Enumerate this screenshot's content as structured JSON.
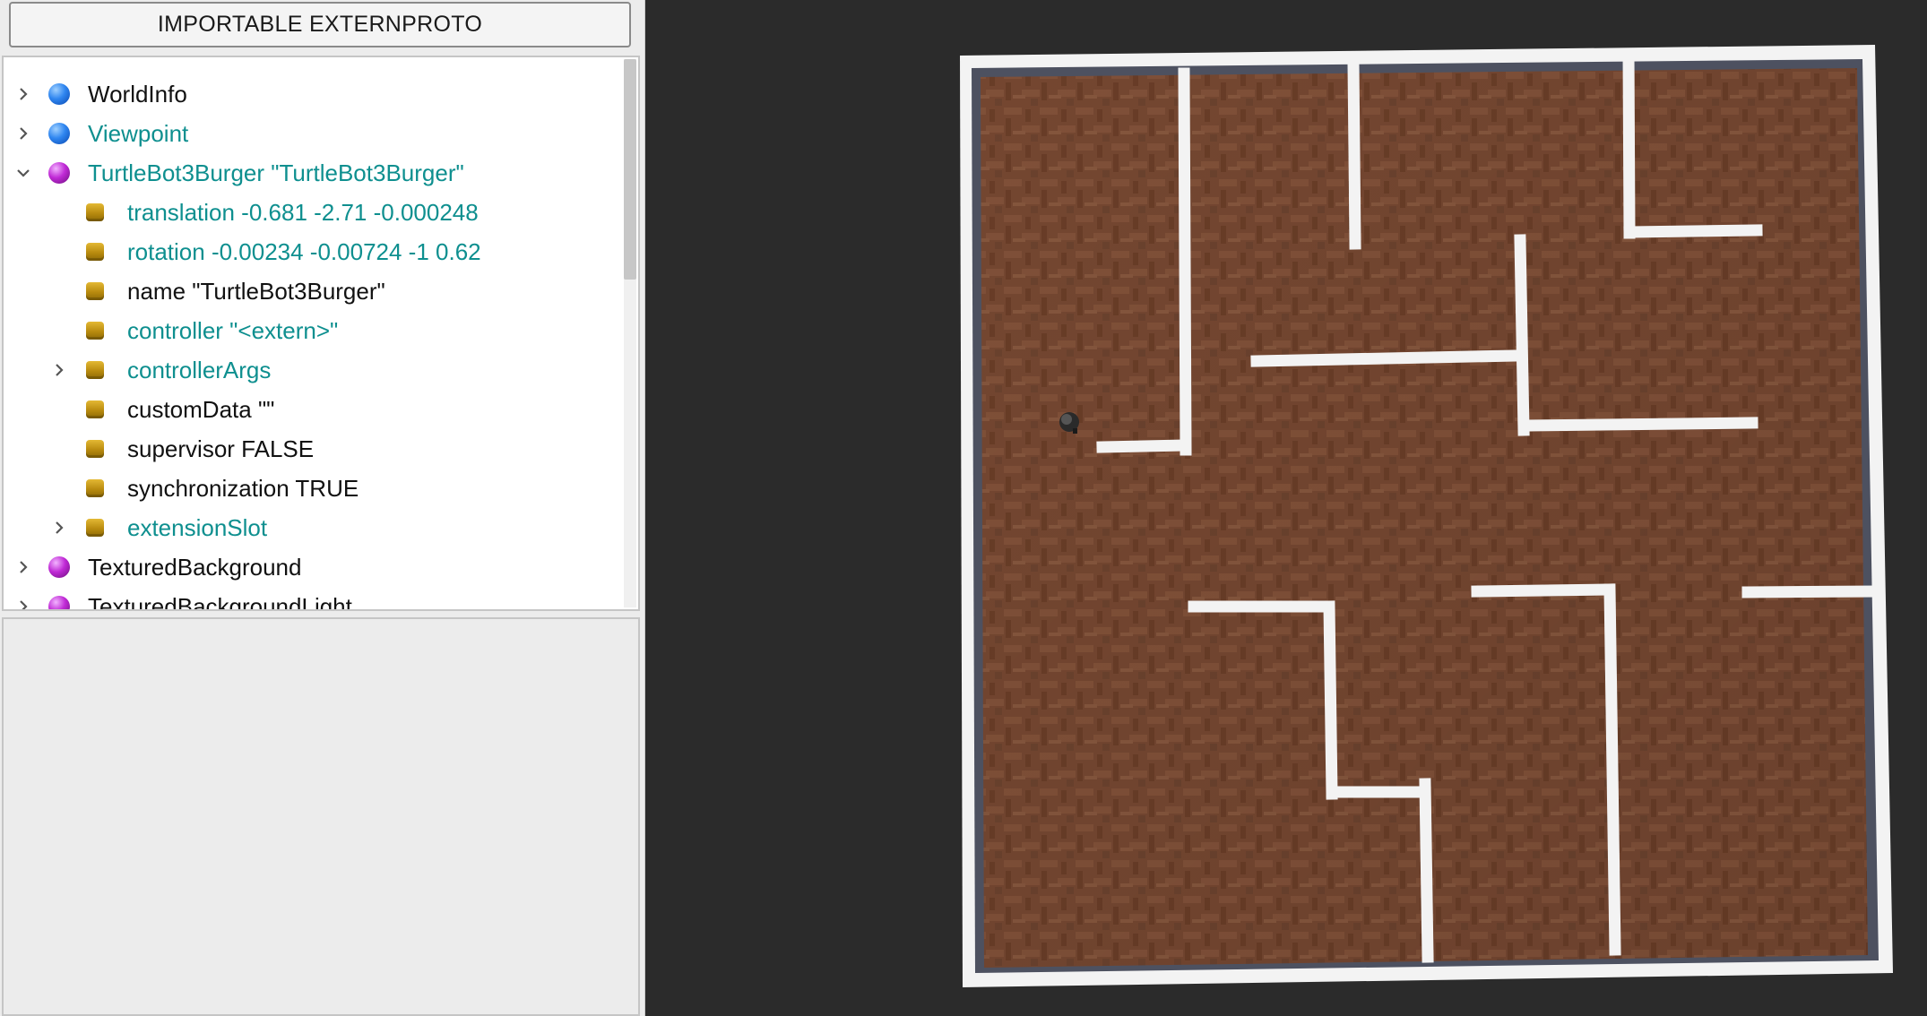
{
  "toolbar": {
    "import_button_label": "IMPORTABLE EXTERNPROTO"
  },
  "scene_tree": {
    "nodes": [
      {
        "label": "WorldInfo",
        "color": "#111111",
        "icon": "blue-sphere-icon",
        "expanded": false
      },
      {
        "label": "Viewpoint",
        "color": "#0e8f8f",
        "icon": "blue-sphere-icon",
        "expanded": false
      },
      {
        "label": "TurtleBot3Burger \"TurtleBot3Burger\"",
        "color": "#0e8f8f",
        "icon": "purple-sphere-icon",
        "expanded": true
      },
      {
        "label": "translation -0.681 -2.71 -0.000248",
        "color": "#0e8f8f",
        "icon": "field-icon"
      },
      {
        "label": "rotation -0.00234 -0.00724 -1 0.62",
        "color": "#0e8f8f",
        "icon": "field-icon"
      },
      {
        "label": "name \"TurtleBot3Burger\"",
        "color": "#111111",
        "icon": "field-icon"
      },
      {
        "label": "controller \"<extern>\"",
        "color": "#0e8f8f",
        "icon": "field-icon"
      },
      {
        "label": "controllerArgs",
        "color": "#0e8f8f",
        "icon": "field-icon",
        "expanded": false
      },
      {
        "label": "customData \"\"",
        "color": "#111111",
        "icon": "field-icon"
      },
      {
        "label": "supervisor FALSE",
        "color": "#111111",
        "icon": "field-icon"
      },
      {
        "label": "synchronization TRUE",
        "color": "#111111",
        "icon": "field-icon"
      },
      {
        "label": "extensionSlot",
        "color": "#0e8f8f",
        "icon": "field-icon",
        "expanded": false
      },
      {
        "label": "TexturedBackground",
        "color": "#111111",
        "icon": "purple-sphere-icon",
        "expanded": false
      },
      {
        "label": "TexturedBackgroundLight",
        "color": "#111111",
        "icon": "purple-sphere-icon",
        "expanded": false
      }
    ]
  },
  "viewport": {
    "scene": "maze arena with robot",
    "floor_color": "#7a4a33",
    "wall_color": "#f2f2f2",
    "background_color": "#2b2b2b"
  }
}
